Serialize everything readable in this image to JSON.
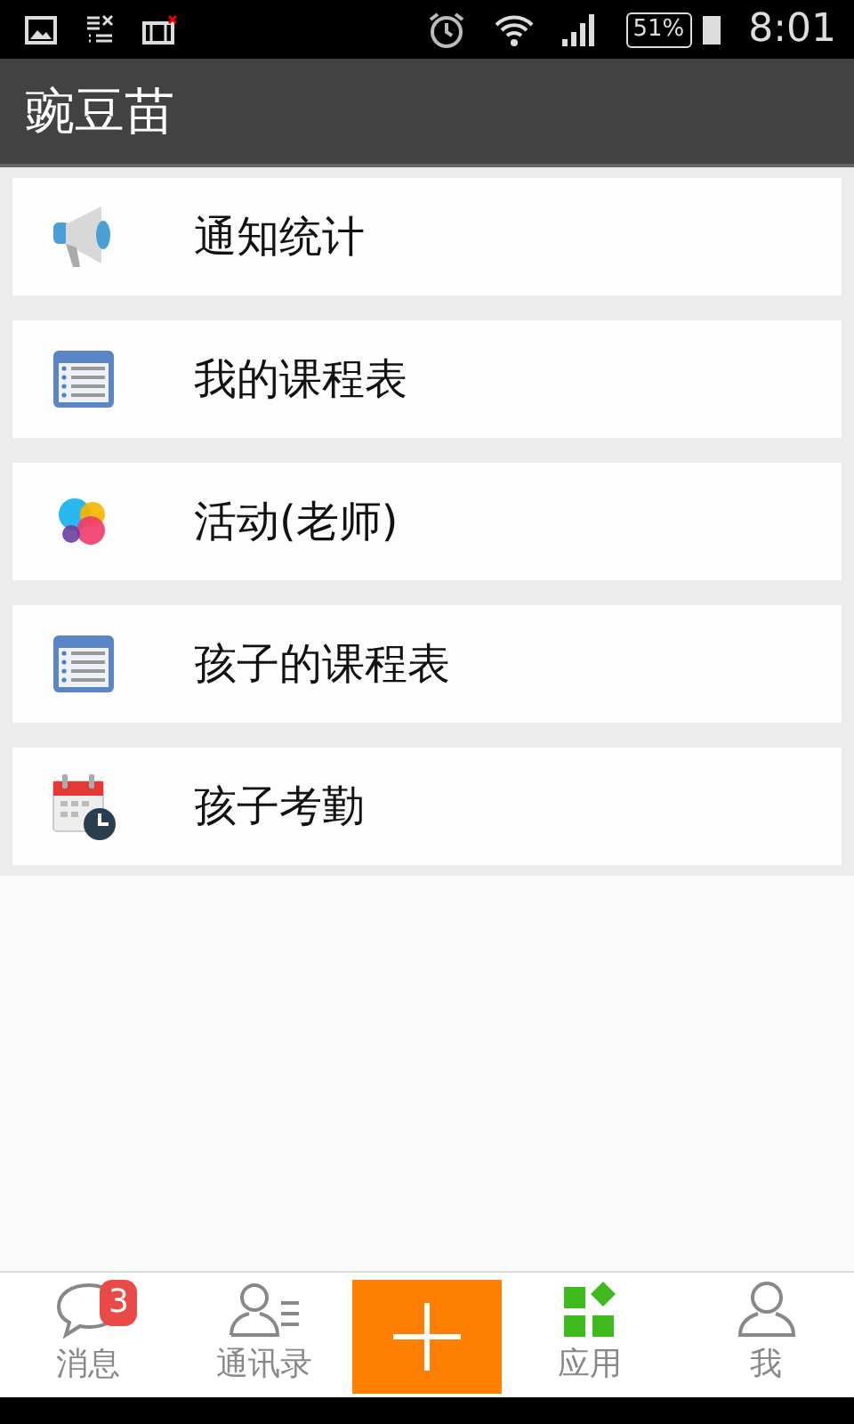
{
  "status_bar": {
    "battery": "51%",
    "time": "8:01"
  },
  "app_bar": {
    "title": "豌豆苗"
  },
  "items": [
    {
      "label": "通知统计",
      "kind": "megaphone"
    },
    {
      "label": "我的课程表",
      "kind": "schedule"
    },
    {
      "label": "活动(老师)",
      "kind": "bubbles"
    },
    {
      "label": "孩子的课程表",
      "kind": "schedule"
    },
    {
      "label": "孩子考勤",
      "kind": "calendar"
    }
  ],
  "tabs": [
    {
      "label": "消息",
      "kind": "chat",
      "selected": false,
      "badge": "3"
    },
    {
      "label": "通讯录",
      "kind": "contacts",
      "selected": false
    },
    {
      "kind": "add"
    },
    {
      "label": "应用",
      "kind": "apps",
      "selected": true
    },
    {
      "label": "我",
      "kind": "me",
      "selected": false
    }
  ]
}
